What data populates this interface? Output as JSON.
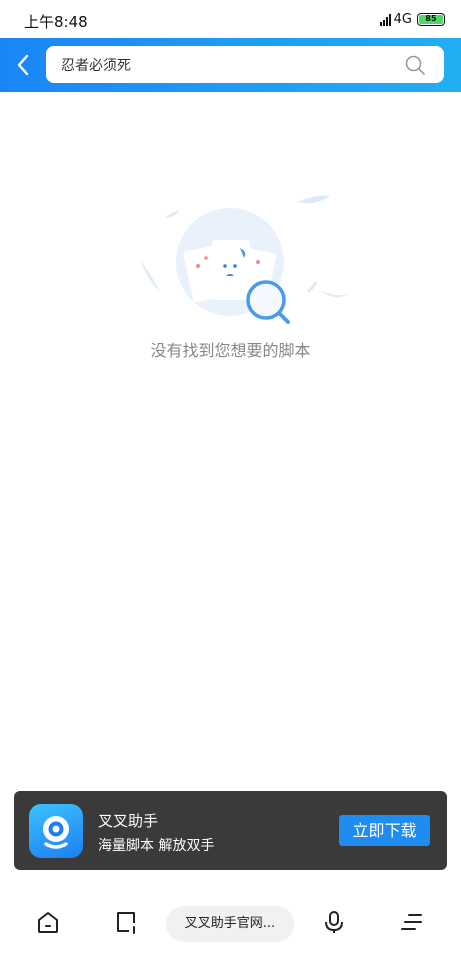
{
  "status_bar": {
    "time": "上午8:48",
    "network": "4G",
    "battery": "85",
    "battery_color": "#4cd964"
  },
  "search": {
    "query": "忍者必须死",
    "back_icon": "chevron-left-icon",
    "search_icon": "search-icon",
    "header_gradient": [
      "#1a86f6",
      "#22aef3"
    ]
  },
  "empty_state": {
    "message": "没有找到您想要的脚本",
    "illustration": "empty-search-illustration"
  },
  "promo": {
    "app_name": "叉叉助手",
    "tagline": "海量脚本  解放双手",
    "button_label": "立即下载",
    "background": "#3a3a3a",
    "button_color": "#1f8cf2"
  },
  "bottom_nav": {
    "home_icon": "home-icon",
    "tabs_icon": "tabs-icon",
    "current_page": "叉叉助手官网...",
    "mic_icon": "microphone-icon",
    "menu_icon": "menu-icon"
  }
}
